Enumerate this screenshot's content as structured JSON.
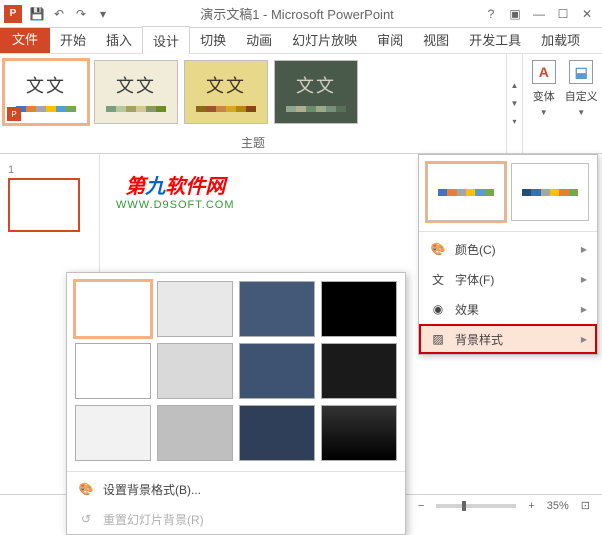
{
  "title": "演示文稿1 - Microsoft PowerPoint",
  "tabs": {
    "file": "文件",
    "items": [
      "开始",
      "插入",
      "设计",
      "切换",
      "动画",
      "幻灯片放映",
      "审阅",
      "视图",
      "开发工具",
      "加载项"
    ],
    "active": "设计"
  },
  "ribbon": {
    "themes_label": "主题",
    "themes": [
      {
        "text": "文文",
        "textColor": "#3b3b3b",
        "bg": "#ffffff",
        "colors": [
          "#4472c4",
          "#ed7d31",
          "#a5a5a5",
          "#ffc000",
          "#5b9bd5",
          "#70ad47"
        ],
        "selected": true,
        "appIcon": true
      },
      {
        "text": "文文",
        "textColor": "#3b3b3b",
        "bg": "#f0ecd8",
        "colors": [
          "#7a9e7e",
          "#b5c99a",
          "#a6a45c",
          "#d4c98b",
          "#8a9a5b",
          "#6b8e23"
        ]
      },
      {
        "text": "文文",
        "textColor": "#403222",
        "bg": "#e8d98a",
        "colors": [
          "#8b6914",
          "#a0522d",
          "#cd853f",
          "#daa520",
          "#b8860b",
          "#8b4513"
        ]
      },
      {
        "text": "文文",
        "textColor": "#d0d0c0",
        "bg": "#4a5a4a",
        "colors": [
          "#8fa68e",
          "#b0b090",
          "#6b8e6b",
          "#9aab8a",
          "#788f78",
          "#5a6f5a"
        ]
      }
    ],
    "variants_label": "变体",
    "customize_label": "自定义"
  },
  "slide": {
    "number": "1"
  },
  "watermark": {
    "line1_a": "第",
    "line1_b": "九",
    "line1_c": "软件网",
    "line2": "WWW.D9SOFT.COM"
  },
  "variants_menu": {
    "thumbs": [
      {
        "colors": [
          "#4472c4",
          "#ed7d31",
          "#a5a5a5",
          "#ffc000",
          "#5b9bd5",
          "#70ad47"
        ],
        "selected": true
      },
      {
        "colors": [
          "#1f4e79",
          "#2e75b6",
          "#a5a5a5",
          "#ffc000",
          "#ed7d31",
          "#70ad47"
        ]
      }
    ],
    "items": [
      {
        "icon": "colors",
        "label": "颜色(C)"
      },
      {
        "icon": "fonts",
        "label": "字体(F)"
      },
      {
        "icon": "effects",
        "label": "效果"
      },
      {
        "icon": "bgstyle",
        "label": "背景样式",
        "highlight": true
      }
    ]
  },
  "bg_gallery": {
    "swatches": [
      {
        "bg": "#ffffff",
        "selected": true
      },
      {
        "bg": "#e8e8e8"
      },
      {
        "bg": "#445878"
      },
      {
        "bg": "#000000"
      },
      {
        "bg": "#ffffff",
        "border": "#aaa"
      },
      {
        "bg": "#d9d9d9"
      },
      {
        "bg": "#3e5372"
      },
      {
        "bg": "#1a1a1a"
      },
      {
        "bg": "#f2f2f2"
      },
      {
        "bg": "#bfbfbf"
      },
      {
        "bg": "#2f3f5a"
      },
      {
        "bg": "linear-gradient(#333,#000)"
      }
    ],
    "format_bg": "设置背景格式(B)...",
    "reset_bg": "重置幻灯片背景(R)"
  },
  "status": {
    "zoom": "35%"
  }
}
